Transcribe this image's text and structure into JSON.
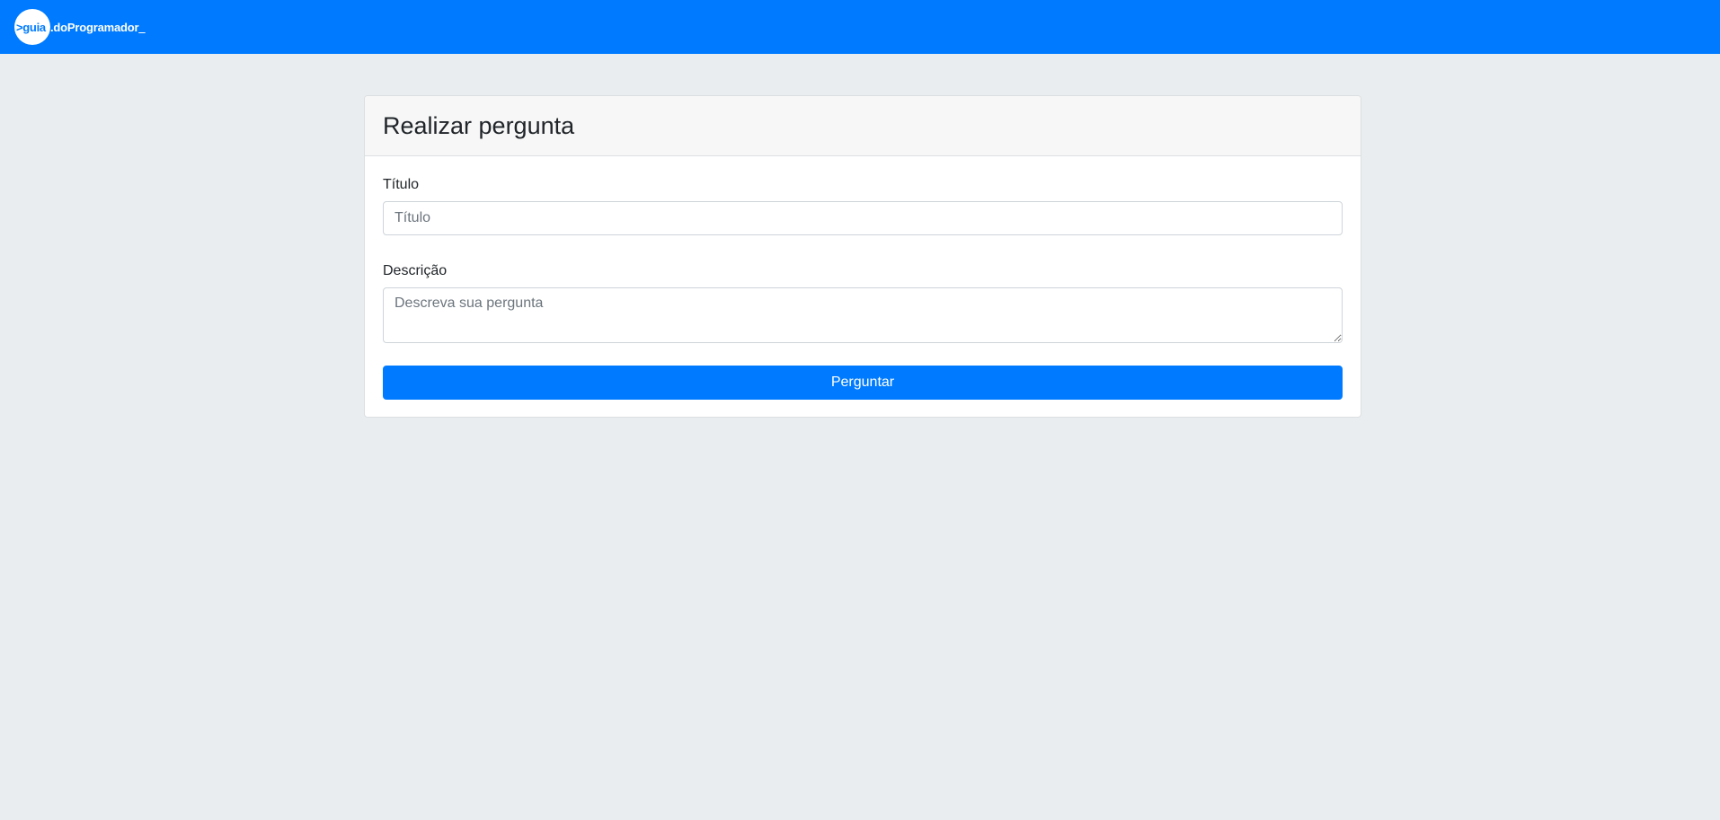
{
  "navbar": {
    "logo": {
      "prefix": ">guia",
      "text": ".doProgramador",
      "suffix": "_"
    },
    "background_color": "#007bff"
  },
  "card": {
    "title": "Realizar pergunta",
    "form": {
      "title_label": "Título",
      "title_placeholder": "Título",
      "title_value": "",
      "description_label": "Descrição",
      "description_placeholder": "Descreva sua pergunta",
      "description_value": "",
      "submit_label": "Perguntar"
    }
  },
  "colors": {
    "primary": "#007bff",
    "page_background": "#e9edf0",
    "card_header_background": "#f7f7f7"
  }
}
